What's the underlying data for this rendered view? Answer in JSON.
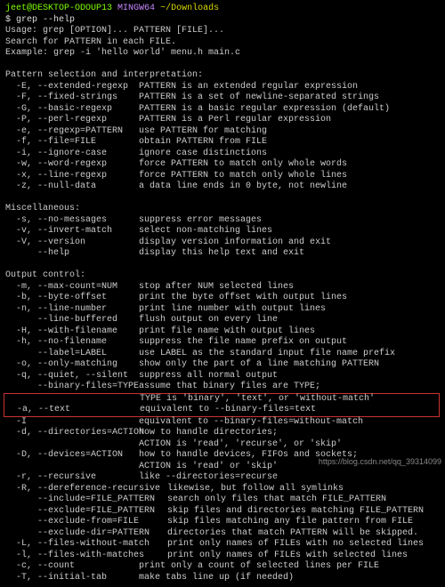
{
  "prompt": {
    "user": "jeet@DESKTOP-ODOUP13",
    "env": "MINGW64",
    "path": "~/Downloads",
    "cmd": "$ grep --help"
  },
  "usage": "Usage: grep [OPTION]... PATTERN [FILE]...",
  "search": "Search for PATTERN in each FILE.",
  "example": "Example: grep -i 'hello world' menu.h main.c",
  "sec1": "Pattern selection and interpretation:",
  "o_E": {
    "f": "  -E, --extended-regexp",
    "d": "PATTERN is an extended regular expression"
  },
  "o_F": {
    "f": "  -F, --fixed-strings",
    "d": "PATTERN is a set of newline-separated strings"
  },
  "o_G": {
    "f": "  -G, --basic-regexp",
    "d": "PATTERN is a basic regular expression (default)"
  },
  "o_P": {
    "f": "  -P, --perl-regexp",
    "d": "PATTERN is a Perl regular expression"
  },
  "o_e": {
    "f": "  -e, --regexp=PATTERN",
    "d": "use PATTERN for matching"
  },
  "o_f": {
    "f": "  -f, --file=FILE",
    "d": "obtain PATTERN from FILE"
  },
  "o_i": {
    "f": "  -i, --ignore-case",
    "d": "ignore case distinctions"
  },
  "o_w": {
    "f": "  -w, --word-regexp",
    "d": "force PATTERN to match only whole words"
  },
  "o_x": {
    "f": "  -x, --line-regexp",
    "d": "force PATTERN to match only whole lines"
  },
  "o_z": {
    "f": "  -z, --null-data",
    "d": "a data line ends in 0 byte, not newline"
  },
  "sec2": "Miscellaneous:",
  "o_s": {
    "f": "  -s, --no-messages",
    "d": "suppress error messages"
  },
  "o_v": {
    "f": "  -v, --invert-match",
    "d": "select non-matching lines"
  },
  "o_V": {
    "f": "  -V, --version",
    "d": "display version information and exit"
  },
  "o_h2": {
    "f": "      --help",
    "d": "display this help text and exit"
  },
  "sec3": "Output control:",
  "o_m": {
    "f": "  -m, --max-count=NUM",
    "d": "stop after NUM selected lines"
  },
  "o_b": {
    "f": "  -b, --byte-offset",
    "d": "print the byte offset with output lines"
  },
  "o_n": {
    "f": "  -n, --line-number",
    "d": "print line number with output lines"
  },
  "o_lb": {
    "f": "      --line-buffered",
    "d": "flush output on every line"
  },
  "o_H": {
    "f": "  -H, --with-filename",
    "d": "print file name with output lines"
  },
  "o_hn": {
    "f": "  -h, --no-filename",
    "d": "suppress the file name prefix on output"
  },
  "o_lab": {
    "f": "      --label=LABEL",
    "d": "use LABEL as the standard input file name prefix"
  },
  "o_o": {
    "f": "  -o, --only-matching",
    "d": "show only the part of a line matching PATTERN"
  },
  "o_q": {
    "f": "  -q, --quiet, --silent",
    "d": "suppress all normal output"
  },
  "o_bf": {
    "f": "      --binary-files=TYPE",
    "d": "assume that binary files are TYPE;"
  },
  "o_bf2": {
    "f": "",
    "d": "TYPE is 'binary', 'text', or 'without-match'"
  },
  "o_a": {
    "f": "  -a, --text",
    "d": "equivalent to --binary-files=text"
  },
  "o_I": {
    "f": "  -I",
    "d": "equivalent to --binary-files=without-match"
  },
  "o_d": {
    "f": "  -d, --directories=ACTION",
    "d": "how to handle directories;"
  },
  "o_d2": {
    "f": "",
    "d": "ACTION is 'read', 'recurse', or 'skip'"
  },
  "o_D": {
    "f": "  -D, --devices=ACTION",
    "d": "how to handle devices, FIFOs and sockets;"
  },
  "o_D2": {
    "f": "",
    "d": "ACTION is 'read' or 'skip'"
  },
  "o_r": {
    "f": "  -r, --recursive",
    "d": "like --directories=recurse"
  },
  "o_R": {
    "f": "  -R, --dereference-recursive",
    "d": "  likewise, but follow all symlinks"
  },
  "o_inc": {
    "f": "      --include=FILE_PATTERN",
    "d": "  search only files that match FILE_PATTERN"
  },
  "o_exc": {
    "f": "      --exclude=FILE_PATTERN",
    "d": "  skip files and directories matching FILE_PATTERN"
  },
  "o_ef": {
    "f": "      --exclude-from=FILE",
    "d": "  skip files matching any file pattern from FILE"
  },
  "o_ed": {
    "f": "      --exclude-dir=PATTERN",
    "d": "  directories that match PATTERN will be skipped."
  },
  "o_L": {
    "f": "  -L, --files-without-match",
    "d": "  print only names of FILEs with no selected lines"
  },
  "o_l": {
    "f": "  -l, --files-with-matches",
    "d": "  print only names of FILEs with selected lines"
  },
  "o_c": {
    "f": "  -c, --count",
    "d": "print only a count of selected lines per FILE"
  },
  "o_T": {
    "f": "  -T, --initial-tab",
    "d": "make tabs line up (if needed)"
  },
  "watermark": "https://blog.csdn.net/qq_39314099"
}
